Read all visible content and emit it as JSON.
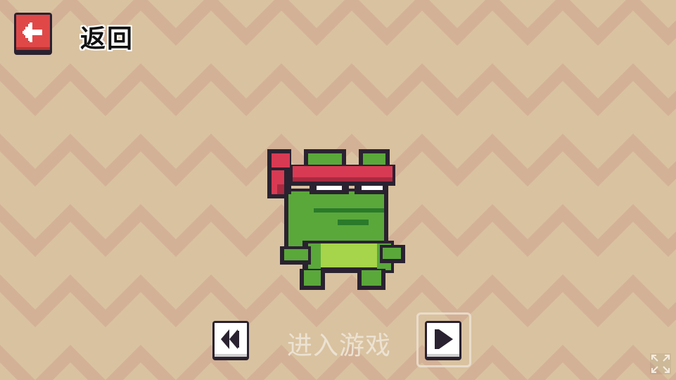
{
  "header": {
    "back_label": "返回",
    "back_icon": "arrow-left-icon"
  },
  "character": {
    "name_icon": "ninja-frog-sprite"
  },
  "footer": {
    "start_label": "进入游戏",
    "prev_icon": "previous-arrow-icon",
    "next_icon": "next-arrow-icon",
    "fullscreen_icon": "fullscreen-icon"
  },
  "colors": {
    "background_light": "#d9c2a0",
    "background_dark": "#d3b196",
    "back_button": "#e04848",
    "frog_green": "#5aa83a",
    "headband": "#d83a54"
  }
}
